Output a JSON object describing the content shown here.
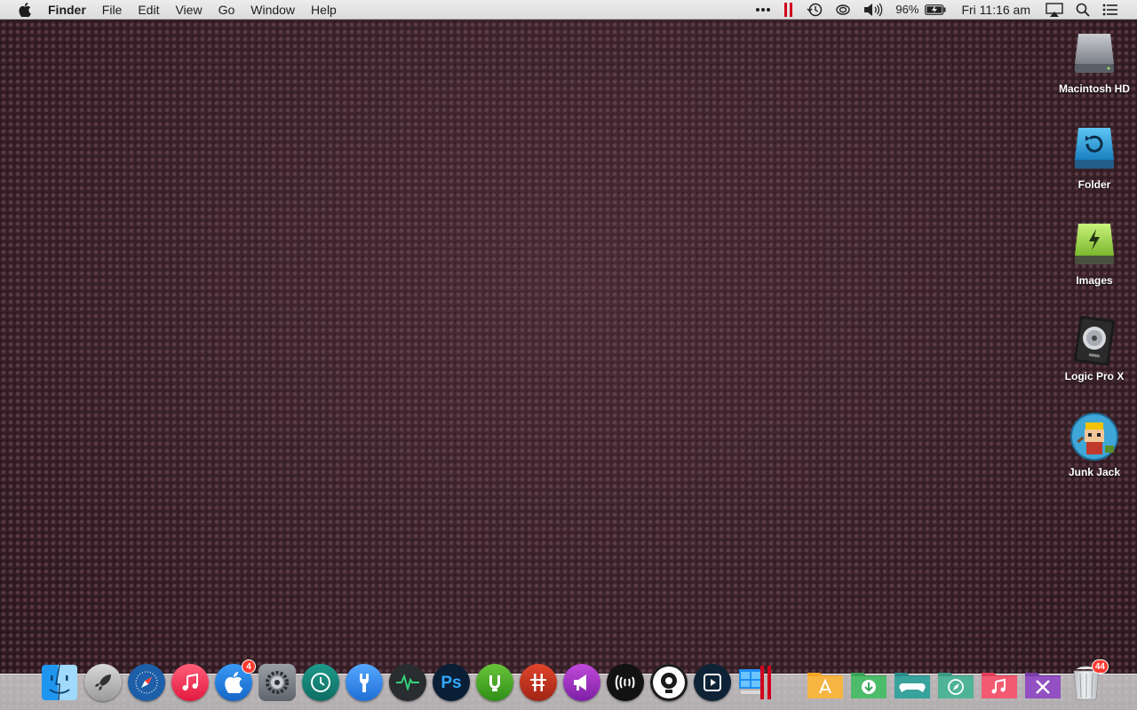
{
  "menubar": {
    "app_name": "Finder",
    "menus": [
      "File",
      "Edit",
      "View",
      "Go",
      "Window",
      "Help"
    ],
    "battery_percent": "96%",
    "clock": "Fri 11:16 am"
  },
  "desktop_icons": [
    {
      "label": "Macintosh HD",
      "icon": "hard-drive-icon"
    },
    {
      "label": "Folder",
      "icon": "time-machine-drive-icon"
    },
    {
      "label": "Images",
      "icon": "external-drive-icon"
    },
    {
      "label": "Logic Pro X",
      "icon": "logic-pro-icon"
    },
    {
      "label": "Junk Jack",
      "icon": "junk-jack-game-icon"
    }
  ],
  "dock": {
    "app_store_badge": "4",
    "trash_badge": "44",
    "apps": [
      "finder",
      "launchpad",
      "safari",
      "itunes",
      "app-store",
      "system-preferences",
      "time-machine",
      "utilities",
      "activity-monitor",
      "photoshop",
      "utorrent",
      "parallels",
      "speaker-app",
      "airplay-app",
      "camera-app",
      "screen-recorder",
      "windows-parallels"
    ],
    "folders": [
      "applications",
      "downloads",
      "games",
      "safari-folder",
      "music",
      "utilities-folder"
    ]
  },
  "colors": {
    "wallpaper": "#3a2229",
    "menubar": "#e4e4e4",
    "badge": "#ff3b30"
  }
}
